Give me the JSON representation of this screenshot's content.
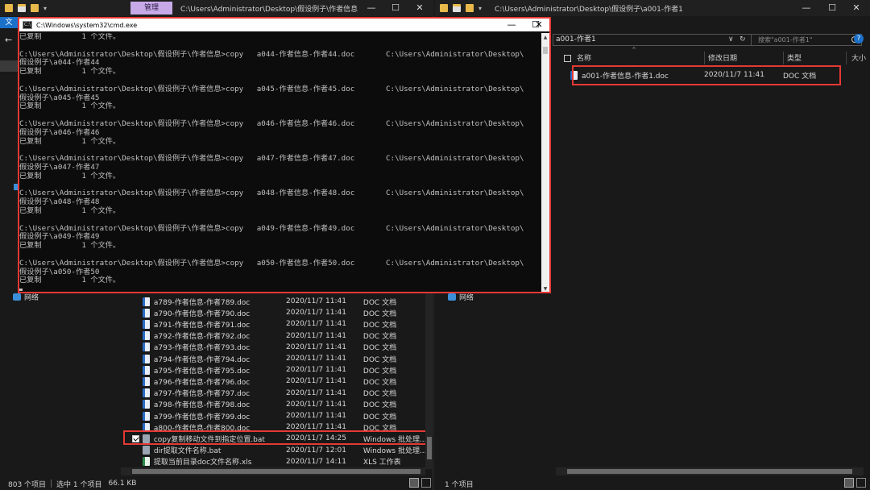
{
  "left_explorer": {
    "manage_tab": "管理",
    "title_path": "C:\\Users\\Administrator\\Desktop\\假设例子\\作者信息",
    "ribbon_file": "文",
    "nav_network": "网络",
    "files": [
      {
        "name": "a789-作者信息-作者789.doc",
        "date": "2020/11/7 11:41",
        "type": "DOC 文档",
        "icon": "doc"
      },
      {
        "name": "a790-作者信息-作者790.doc",
        "date": "2020/11/7 11:41",
        "type": "DOC 文档",
        "icon": "doc"
      },
      {
        "name": "a791-作者信息-作者791.doc",
        "date": "2020/11/7 11:41",
        "type": "DOC 文档",
        "icon": "doc"
      },
      {
        "name": "a792-作者信息-作者792.doc",
        "date": "2020/11/7 11:41",
        "type": "DOC 文档",
        "icon": "doc"
      },
      {
        "name": "a793-作者信息-作者793.doc",
        "date": "2020/11/7 11:41",
        "type": "DOC 文档",
        "icon": "doc"
      },
      {
        "name": "a794-作者信息-作者794.doc",
        "date": "2020/11/7 11:41",
        "type": "DOC 文档",
        "icon": "doc"
      },
      {
        "name": "a795-作者信息-作者795.doc",
        "date": "2020/11/7 11:41",
        "type": "DOC 文档",
        "icon": "doc"
      },
      {
        "name": "a796-作者信息-作者796.doc",
        "date": "2020/11/7 11:41",
        "type": "DOC 文档",
        "icon": "doc"
      },
      {
        "name": "a797-作者信息-作者797.doc",
        "date": "2020/11/7 11:41",
        "type": "DOC 文档",
        "icon": "doc"
      },
      {
        "name": "a798-作者信息-作者798.doc",
        "date": "2020/11/7 11:41",
        "type": "DOC 文档",
        "icon": "doc"
      },
      {
        "name": "a799-作者信息-作者799.doc",
        "date": "2020/11/7 11:41",
        "type": "DOC 文档",
        "icon": "doc"
      },
      {
        "name": "a800-作者信息-作者800.doc",
        "date": "2020/11/7 11:41",
        "type": "DOC 文档",
        "icon": "doc"
      },
      {
        "name": "copy复制移动文件到指定位置.bat",
        "date": "2020/11/7 14:25",
        "type": "Windows 批处理...",
        "icon": "bat",
        "checked": true
      },
      {
        "name": "dir提取文件名称.bat",
        "date": "2020/11/7 12:01",
        "type": "Windows 批处理...",
        "icon": "bat"
      },
      {
        "name": "提取当前目录doc文件名称.xls",
        "date": "2020/11/7 14:11",
        "type": "XLS 工作表",
        "icon": "xls"
      }
    ],
    "status": {
      "count": "803 个项目",
      "selected": "选中 1 个项目",
      "size": "66.1 KB"
    }
  },
  "cmd": {
    "title": "C:\\Windows\\system32\\cmd.exe",
    "lines": [
      "已复制         1 个文件。",
      "",
      "C:\\Users\\Administrator\\Desktop\\假设例子\\作者信息>copy   a044-作者信息-作者44.doc       C:\\Users\\Administrator\\Desktop\\",
      "假设例子\\a044-作者44",
      "已复制         1 个文件。",
      "",
      "C:\\Users\\Administrator\\Desktop\\假设例子\\作者信息>copy   a045-作者信息-作者45.doc       C:\\Users\\Administrator\\Desktop\\",
      "假设例子\\a045-作者45",
      "已复制         1 个文件。",
      "",
      "C:\\Users\\Administrator\\Desktop\\假设例子\\作者信息>copy   a046-作者信息-作者46.doc       C:\\Users\\Administrator\\Desktop\\",
      "假设例子\\a046-作者46",
      "已复制         1 个文件。",
      "",
      "C:\\Users\\Administrator\\Desktop\\假设例子\\作者信息>copy   a047-作者信息-作者47.doc       C:\\Users\\Administrator\\Desktop\\",
      "假设例子\\a047-作者47",
      "已复制         1 个文件。",
      "",
      "C:\\Users\\Administrator\\Desktop\\假设例子\\作者信息>copy   a048-作者信息-作者48.doc       C:\\Users\\Administrator\\Desktop\\",
      "假设例子\\a048-作者48",
      "已复制         1 个文件。",
      "",
      "C:\\Users\\Administrator\\Desktop\\假设例子\\作者信息>copy   a049-作者信息-作者49.doc       C:\\Users\\Administrator\\Desktop\\",
      "假设例子\\a049-作者49",
      "已复制         1 个文件。",
      "",
      "C:\\Users\\Administrator\\Desktop\\假设例子\\作者信息>copy   a050-作者信息-作者50.doc       C:\\Users\\Administrator\\Desktop\\",
      "假设例子\\a050-作者50",
      "已复制         1 个文件。"
    ]
  },
  "right_explorer": {
    "title_path": "C:\\Users\\Administrator\\Desktop\\假设例子\\a001-作者1",
    "address": "a001-作者1",
    "search_placeholder": "搜索\"a001-作者1\"",
    "columns": {
      "name": "名称",
      "date": "修改日期",
      "type": "类型",
      "size": "大小"
    },
    "nav_network": "网络",
    "file": {
      "name": "a001-作者信息-作者1.doc",
      "date": "2020/11/7 11:41",
      "type": "DOC 文档"
    },
    "status": {
      "count": "1 个项目"
    }
  },
  "colors": {
    "highlight": "#e53935",
    "manage_tab": "#c7a9e8",
    "accent": "#1b70c9"
  }
}
